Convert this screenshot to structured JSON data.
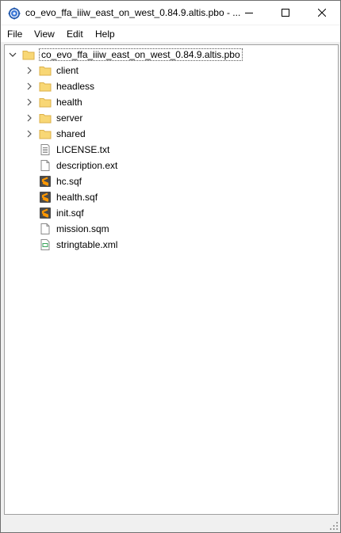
{
  "window": {
    "title": "co_evo_ffa_iiiw_east_on_west_0.84.9.altis.pbo - ..."
  },
  "menu": {
    "items": [
      "File",
      "View",
      "Edit",
      "Help"
    ]
  },
  "tree": {
    "root": {
      "label": "co_evo_ffa_iiiw_east_on_west_0.84.9.altis.pbo",
      "expanded": true,
      "icon": "folder-icon"
    },
    "children": [
      {
        "label": "client",
        "icon": "folder-icon"
      },
      {
        "label": "headless",
        "icon": "folder-icon"
      },
      {
        "label": "health",
        "icon": "folder-icon"
      },
      {
        "label": "server",
        "icon": "folder-icon"
      },
      {
        "label": "shared",
        "icon": "folder-icon"
      },
      {
        "label": "LICENSE.txt",
        "icon": "text-file-icon"
      },
      {
        "label": "description.ext",
        "icon": "blank-file-icon"
      },
      {
        "label": "hc.sqf",
        "icon": "sublime-file-icon"
      },
      {
        "label": "health.sqf",
        "icon": "sublime-file-icon"
      },
      {
        "label": "init.sqf",
        "icon": "sublime-file-icon"
      },
      {
        "label": "mission.sqm",
        "icon": "blank-file-icon"
      },
      {
        "label": "stringtable.xml",
        "icon": "xml-file-icon"
      }
    ]
  },
  "colors": {
    "folder": "#f8d775",
    "folder_edge": "#dcb04a",
    "sublime": "#4b4b4b",
    "sublime_s": "#ff9800"
  }
}
